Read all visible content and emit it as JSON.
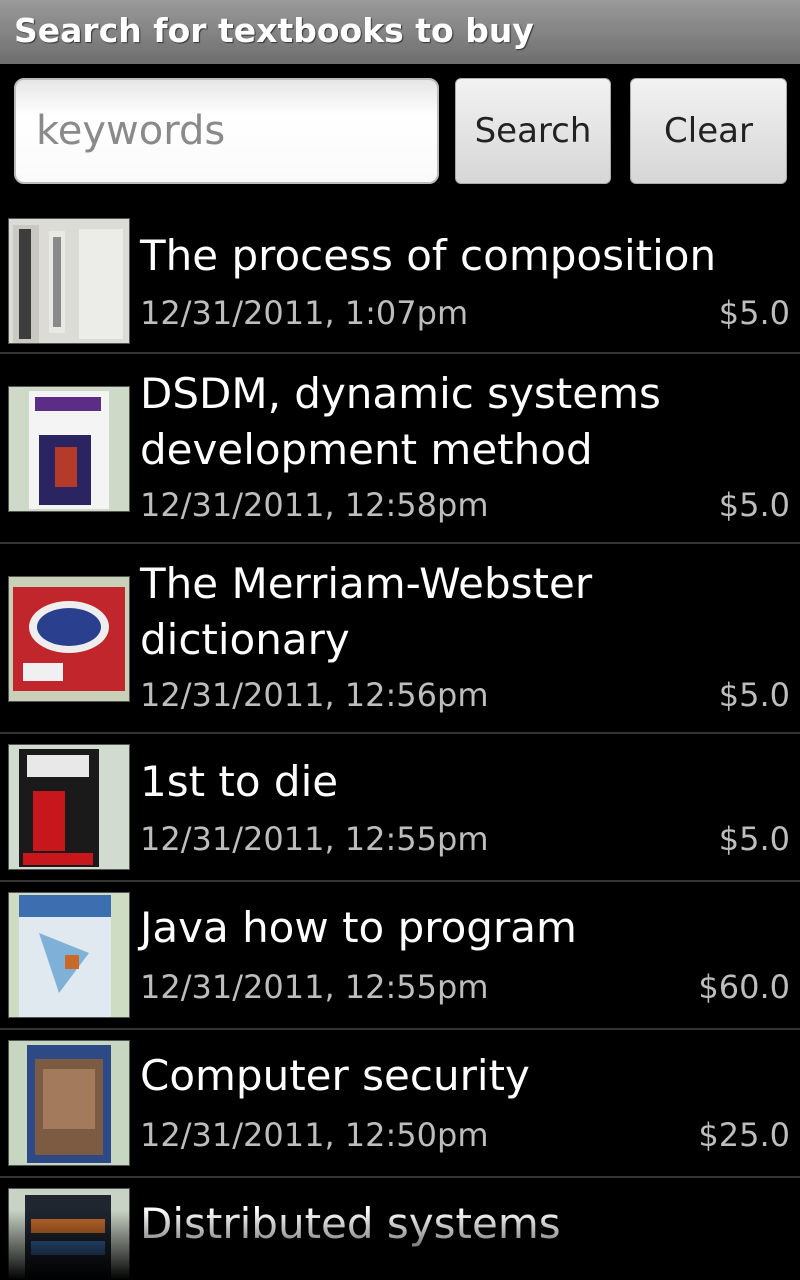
{
  "title": "Search for textbooks to buy",
  "search": {
    "placeholder": "keywords",
    "search_label": "Search",
    "clear_label": "Clear"
  },
  "items": [
    {
      "title": "The process of composition",
      "date": "12/31/2011, 1:07pm",
      "price": "$5.0",
      "icon": "book-cover-composition"
    },
    {
      "title": "DSDM, dynamic systems development method",
      "date": "12/31/2011, 12:58pm",
      "price": "$5.0",
      "icon": "book-cover-dsdm"
    },
    {
      "title": "The Merriam-Webster dictionary",
      "date": "12/31/2011, 12:56pm",
      "price": "$5.0",
      "icon": "book-cover-dictionary"
    },
    {
      "title": "1st to die",
      "date": "12/31/2011, 12:55pm",
      "price": "$5.0",
      "icon": "book-cover-1st-to-die"
    },
    {
      "title": "Java how to program",
      "date": "12/31/2011, 12:55pm",
      "price": "$60.0",
      "icon": "book-cover-java"
    },
    {
      "title": "Computer security",
      "date": "12/31/2011, 12:50pm",
      "price": "$25.0",
      "icon": "book-cover-security"
    },
    {
      "title": "Distributed systems",
      "date": "",
      "price": "",
      "icon": "book-cover-distributed"
    }
  ]
}
